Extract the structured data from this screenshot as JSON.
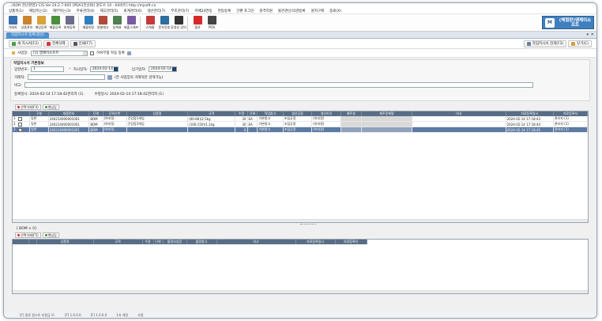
{
  "window": {
    "title": "...ISOft 천년경영3 C/S  Ver.24.2.7.605 [PDA1전산Dl] 원도우 10 - 64비트]  http://mjsoft.co"
  },
  "menus": [
    "상품목(1)",
    "매입목는(2)",
    "재무목는(3)",
    "주류관리(4)",
    "재고관리(5)",
    "회계관리(6)",
    "생산관리(7)",
    "부조관리(7)",
    "카페24연동",
    "현등등록",
    "간편 포그인",
    "원격지원",
    "볼관견신/의견등록",
    "원지구매",
    "종료(X)"
  ],
  "toolbar": [
    {
      "label": "거래처",
      "icon": "building-icon",
      "color": "#3a6fb0"
    },
    {
      "label": "상품관리",
      "icon": "box-icon",
      "color": "#c8832f"
    },
    {
      "label": "매입등록",
      "icon": "cart-in-icon",
      "color": "#d9a23a"
    },
    {
      "label": "매출등록",
      "icon": "cart-out-icon",
      "color": "#4b8f3c"
    },
    {
      "label": "회계등록",
      "icon": "calculator-icon",
      "color": "#6c6c8c"
    },
    {
      "label": "매출현장",
      "icon": "ledger-icon",
      "color": "#2f7fbf"
    },
    {
      "label": "일별재고",
      "icon": "chart-icon",
      "color": "#b04a3a"
    },
    {
      "label": "일계표",
      "icon": "table-icon",
      "color": "#4f7f4f"
    },
    {
      "label": "재출그래프",
      "icon": "graph-icon",
      "color": "#7a5aa0"
    },
    {
      "label": "스케줄",
      "icon": "calendar-icon",
      "color": "#c33a3a"
    },
    {
      "label": "문자전송",
      "icon": "message-icon",
      "color": "#2e6e9e"
    },
    {
      "label": "동영상 강의",
      "icon": "video-icon",
      "color": "#333333"
    },
    {
      "label": "종료",
      "icon": "power-icon",
      "color": "#d62a2a"
    },
    {
      "label": "POS",
      "icon": "pos-icon",
      "color": "#444444"
    }
  ],
  "brand": {
    "line1": "(체험판)엠제이소",
    "line2": "프트"
  },
  "tab": {
    "label": "작업지시서 등록(생산)"
  },
  "actions": {
    "new": "새 지시서(F2)",
    "delete": "전체삭제",
    "print": "인쇄(F7)",
    "search": "작업지시서 검색(F3)",
    "close": "닫기(C)"
  },
  "biz": {
    "label": "사업장:",
    "value": "[1] 엠제이소프트",
    "auto_label": "하위부품 자동 등록"
  },
  "form": {
    "legend": "작업지시서 기본정보",
    "no_label": "입현번호:",
    "no_value": "1",
    "order_date_label": "지시일자:",
    "order_date": "2024-02-14",
    "due_label": "납기일자:",
    "due_date": "2024-02-14",
    "client_label": "거래처:",
    "client_hint": "(한 사업장의 거래처만 검색가능)",
    "memo_label": "비고:",
    "reg_info": "등록일시: 2024-02-14 17:18:42관리자 (1)",
    "mod_info": "수정일시: 2024-02-14 17:18:42관리자 (1)"
  },
  "grid1": {
    "toolbar": [
      "선택삭제(F4)",
      "행삽입"
    ],
    "columns": [
      "",
      "구분",
      "제품번호",
      "단위",
      "단위순번",
      "상품명",
      "규격",
      "수량",
      "단위",
      "작업창고",
      "생산공정",
      "생산라인",
      "재주설",
      "재주문제명",
      "비고",
      "지료등록일시",
      "지료등록자"
    ],
    "rows": [
      [
        "1",
        "일반",
        "240214000001001",
        "BOM",
        "(하지정..",
        "건강즙1개입",
        "(60-80)/2.5kg",
        "30",
        "EA",
        "기본창고",
        "조립공정",
        "(미지정)",
        "",
        "",
        "",
        "2024-02-14 17:18:43",
        "관리자 (1)"
      ],
      [
        "2",
        "일반",
        "240214000001001",
        "BOM",
        "(하지정..",
        "건강즙3개입",
        "(100-150)/1.2kg",
        "30",
        "EA",
        "기본창고",
        "조립공정",
        "(미지정)",
        "",
        "",
        "",
        "2024-02-14 17:18:44",
        "관리자 (1)"
      ],
      [
        "3",
        "일반",
        "240214000001001",
        "BOM",
        "(하지정..",
        "",
        "",
        "0",
        "",
        "기본창고",
        "조립공정",
        "(미지정)",
        "",
        "",
        "",
        "2024-02-14 17:18:45",
        "관리자 (1)"
      ]
    ]
  },
  "bom": {
    "header": "[ BOM  × 0]",
    "toolbar": [
      "선택삭제(F5)",
      "행삽입"
    ],
    "columns": [
      "",
      "",
      "상품명",
      "규격",
      "수량",
      "단위",
      "불량사업장",
      "불량창고",
      "비고",
      "자료등록일시",
      "자료등록자"
    ]
  },
  "status": [
    "[F] 종료 원스토 지원금 모.",
    "[F] 1.0.0.0",
    "[F] 1.0.0.0",
    "1차 계정",
    "사원"
  ]
}
